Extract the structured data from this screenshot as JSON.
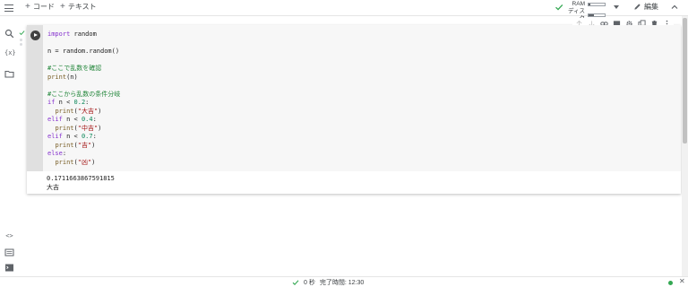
{
  "toolbar": {
    "add_code_label": "コード",
    "add_text_label": "テキスト",
    "ram_label": "RAM",
    "disk_label": "ディスク",
    "ram_usage": 0.12,
    "disk_usage": 0.35,
    "edit_label": "編集"
  },
  "cell": {
    "code_lines": [
      "import random",
      "",
      "n = random.random()",
      "",
      "#ここで乱数を確認",
      "print(n)",
      "",
      "#ここから乱数の条件分岐",
      "if n < 0.2:",
      "  print(\"大吉\")",
      "elif n < 0.4:",
      "  print(\"中吉\")",
      "elif n < 0.7:",
      "  print(\"吉\")",
      "else:",
      "  print(\"凶\")"
    ],
    "output_lines": [
      "0.1711663867591815",
      "大吉"
    ]
  },
  "status": {
    "elapsed": "0 秒",
    "completed": "完了時間: 12:30"
  },
  "colors": {
    "keyword": "#8430ce",
    "number": "#098658",
    "string": "#a31515",
    "comment": "#22863a",
    "success": "#34a853"
  },
  "icons": [
    "menu-icon",
    "search-icon",
    "variables-icon",
    "folder-icon",
    "code-snippets-icon",
    "command-palette-icon",
    "terminal-icon",
    "run-icon",
    "check-icon",
    "pencil-icon",
    "chevron-up-icon"
  ]
}
